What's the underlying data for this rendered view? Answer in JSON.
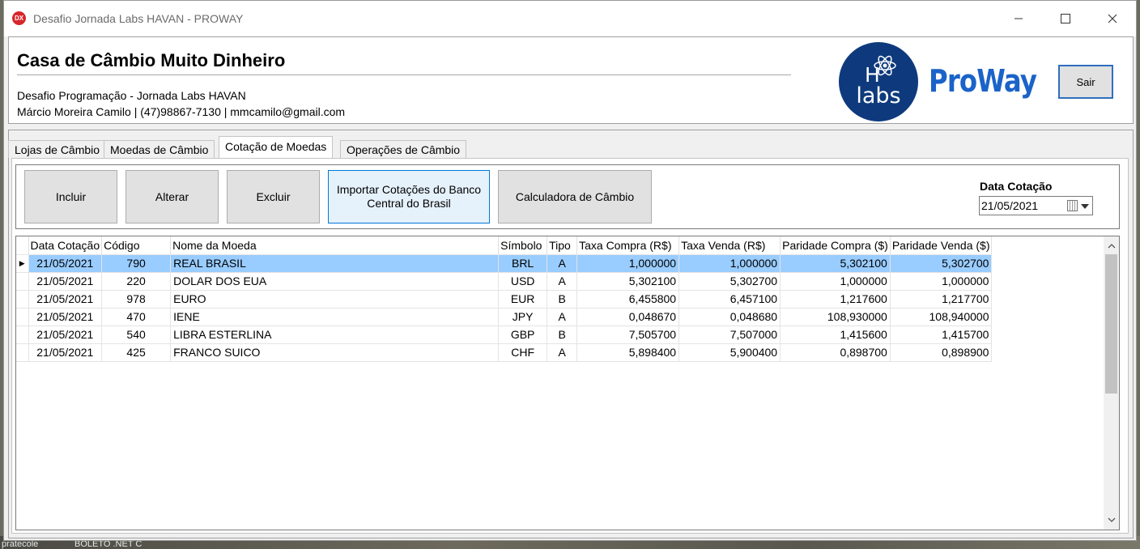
{
  "window": {
    "title": "Desafio Jornada Labs HAVAN - PROWAY",
    "app_icon": "DX"
  },
  "header": {
    "company": "Casa de Câmbio Muito Dinheiro",
    "line1": "Desafio Programação - Jornada Labs HAVAN",
    "line2": "Márcio Moreira Camilo | (47)98867-7130 | mmcamilo@gmail.com",
    "logo1_top": "H",
    "logo1_bottom": "labs",
    "logo2": "ProWay",
    "exit_label": "Sair"
  },
  "tabs": [
    "Lojas de Câmbio",
    "Moedas de Câmbio",
    "Cotação de Moedas",
    "Operações de Câmbio"
  ],
  "active_tab": 2,
  "toolbar": {
    "include": "Incluir",
    "edit": "Alterar",
    "delete": "Excluir",
    "import": "Importar Cotações do Banco Central do Brasil",
    "calculator": "Calculadora de Câmbio",
    "date_label": "Data Cotação",
    "date_value": "21/05/2021"
  },
  "grid": {
    "columns": [
      "Data Cotação",
      "Código",
      "Nome da Moeda",
      "Símbolo",
      "Tipo",
      "Taxa Compra (R$)",
      "Taxa Venda (R$)",
      "Paridade Compra ($)",
      "Paridade Venda ($)"
    ],
    "rows": [
      [
        "21/05/2021",
        "790",
        "REAL BRASIL",
        "BRL",
        "A",
        "1,000000",
        "1,000000",
        "5,302100",
        "5,302700"
      ],
      [
        "21/05/2021",
        "220",
        "DOLAR DOS EUA",
        "USD",
        "A",
        "5,302100",
        "5,302700",
        "1,000000",
        "1,000000"
      ],
      [
        "21/05/2021",
        "978",
        "EURO",
        "EUR",
        "B",
        "6,455800",
        "6,457100",
        "1,217600",
        "1,217700"
      ],
      [
        "21/05/2021",
        "470",
        "IENE",
        "JPY",
        "A",
        "0,048670",
        "0,048680",
        "108,930000",
        "108,940000"
      ],
      [
        "21/05/2021",
        "540",
        "LIBRA ESTERLINA",
        "GBP",
        "B",
        "7,505700",
        "7,507000",
        "1,415600",
        "1,415700"
      ],
      [
        "21/05/2021",
        "425",
        "FRANCO SUICO",
        "CHF",
        "A",
        "5,898400",
        "5,900400",
        "0,898700",
        "0,898900"
      ]
    ],
    "selected_row": 0
  },
  "colors": {
    "selection": "#99ccff",
    "brand_blue": "#1a63c9",
    "logo_navy": "#0e3a7d"
  }
}
